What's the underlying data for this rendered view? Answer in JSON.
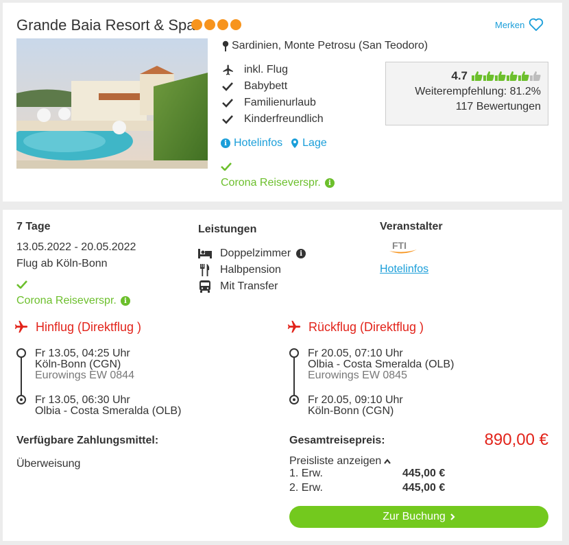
{
  "hotel": {
    "name": "Grande Baia Resort & Spa",
    "stars": 4,
    "merken_label": "Merken",
    "location": "Sardinien, Monte Petrosu (San Teodoro)",
    "features": [
      "inkl. Flug",
      "Babybett",
      "Familienurlaub",
      "Kinderfreundlich"
    ],
    "links": {
      "hotelinfos": "Hotelinfos",
      "lage": "Lage"
    },
    "corona": "Corona Reiseverspr.",
    "rating": {
      "score": "4.7",
      "thumbs": 6,
      "recommendation": "Weiterempfehlung: 81.2%",
      "reviews": "117 Bewertungen"
    }
  },
  "offer": {
    "duration": "7 Tage",
    "dates": "13.05.2022 - 20.05.2022",
    "departure": "Flug ab Köln-Bonn",
    "corona": "Corona Reiseverspr.",
    "leistungen_title": "Leistungen",
    "leistungen": [
      "Doppelzimmer",
      "Halbpension",
      "Mit Transfer"
    ],
    "veranstalter_title": "Veranstalter",
    "veranstalter_logo": "FTI",
    "veranstalter_link": "Hotelinfos",
    "hinflug": {
      "title": "Hinflug (Direktflug )",
      "dep_time": "Fr 13.05, 04:25 Uhr",
      "dep_airport": "Köln-Bonn (CGN)",
      "airline": "Eurowings EW 0844",
      "arr_time": "Fr 13.05, 06:30 Uhr",
      "arr_airport": "Olbia - Costa Smeralda (OLB)"
    },
    "rueckflug": {
      "title": "Rückflug (Direktflug )",
      "dep_time": "Fr 20.05, 07:10 Uhr",
      "dep_airport": "Olbia - Costa Smeralda (OLB)",
      "airline": "Eurowings EW 0845",
      "arr_time": "Fr 20.05, 09:10 Uhr",
      "arr_airport": "Köln-Bonn (CGN)"
    },
    "payment_title": "Verfügbare Zahlungsmittel:",
    "payment_method": "Überweisung",
    "total_label": "Gesamtreisepreis:",
    "total_price": "890,00 €",
    "pricelist_label": "Preisliste anzeigen",
    "prices": [
      {
        "label": "1. Erw.",
        "value": "445,00 €"
      },
      {
        "label": "2. Erw.",
        "value": "445,00 €"
      }
    ],
    "booking_button": "Zur Buchung"
  },
  "colors": {
    "accent_blue": "#1a9ed9",
    "green": "#6cbf2c",
    "red": "#e2231a",
    "star_orange": "#f7941d",
    "button_green": "#73c91e"
  }
}
